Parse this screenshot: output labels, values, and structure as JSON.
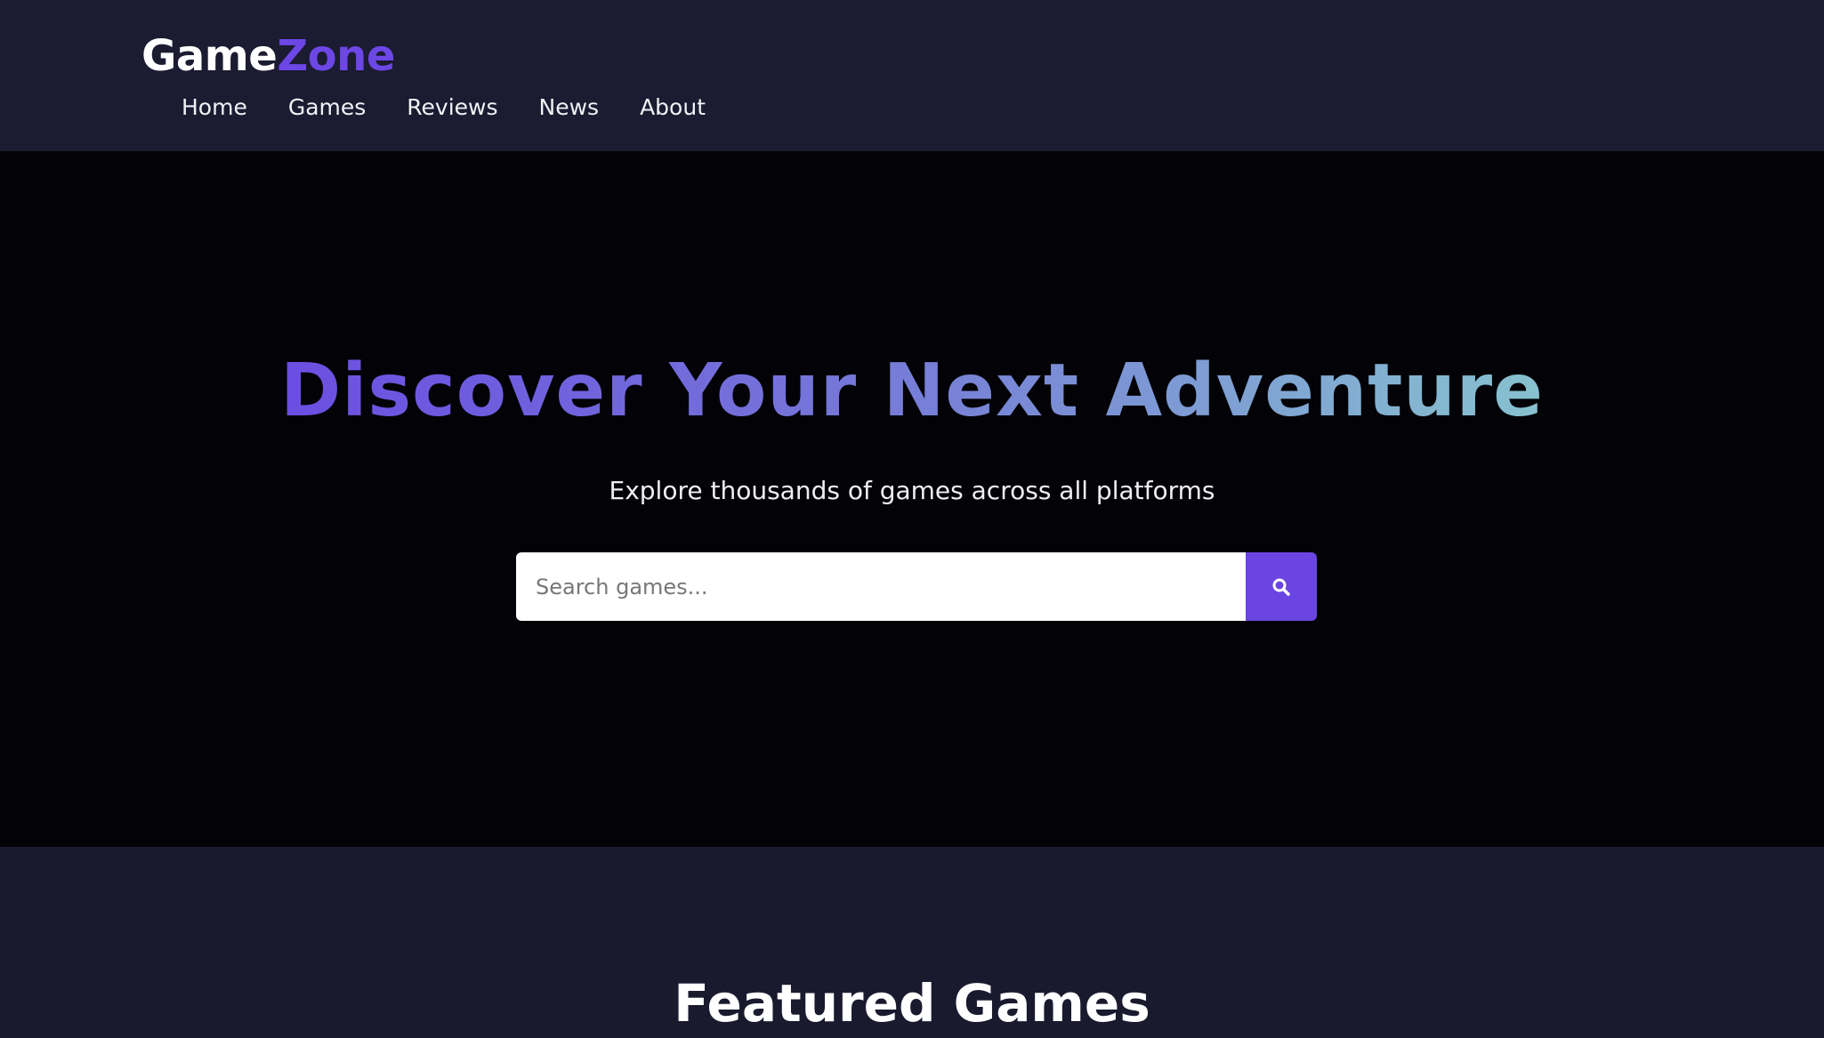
{
  "brand": {
    "name_part1": "Game",
    "name_part2": "Zone"
  },
  "nav": {
    "items": [
      {
        "label": "Home"
      },
      {
        "label": "Games"
      },
      {
        "label": "Reviews"
      },
      {
        "label": "News"
      },
      {
        "label": "About"
      }
    ]
  },
  "hero": {
    "title": "Discover Your Next Adventure",
    "subtitle": "Explore thousands of games across all platforms"
  },
  "search": {
    "placeholder": "Search games...",
    "value": "",
    "button_icon": "search-icon"
  },
  "featured": {
    "title": "Featured Games"
  },
  "colors": {
    "accent": "#6a45e2",
    "header_bg": "#1b1b31",
    "hero_bg": "#030307",
    "section_bg": "#191a2e",
    "title_gradient_start": "#6b4ee2",
    "title_gradient_end": "#87c2cf"
  }
}
